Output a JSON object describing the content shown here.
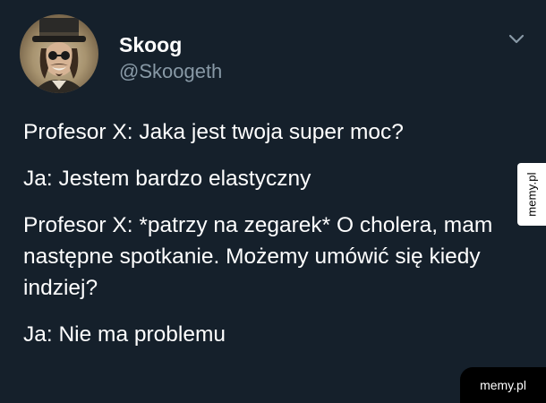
{
  "tweet": {
    "author": {
      "display_name": "Skoog",
      "handle": "@Skoogeth",
      "avatar_icon": "avatar-photo"
    },
    "menu_icon": "chevron-down-icon",
    "lines": [
      "Profesor X: Jaka jest twoja super moc?",
      "Ja: Jestem bardzo elastyczny",
      "Profesor X: *patrzy na zegarek* O cholera, mam następne spotkanie. Możemy umówić się kiedy indziej?",
      "Ja: Nie ma problemu"
    ]
  },
  "watermarks": {
    "side": "memy.pl",
    "corner": "memy.pl"
  },
  "colors": {
    "background": "#15202b",
    "text": "#ffffff",
    "secondary_text": "#8899a6"
  }
}
